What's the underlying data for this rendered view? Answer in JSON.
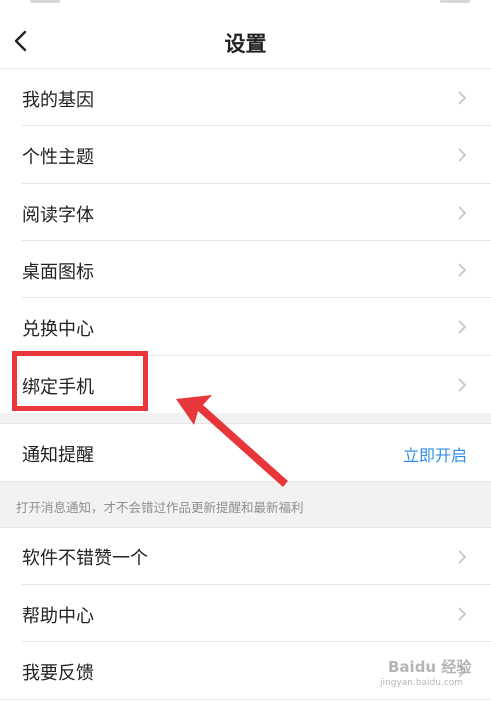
{
  "header": {
    "title": "设置"
  },
  "group1": [
    {
      "label": "我的基因"
    },
    {
      "label": "个性主题"
    },
    {
      "label": "阅读字体"
    },
    {
      "label": "桌面图标"
    },
    {
      "label": "兑换中心"
    },
    {
      "label": "绑定手机"
    }
  ],
  "notify": {
    "label": "通知提醒",
    "action": "立即开启",
    "hint": "打开消息通知，才不会错过作品更新提醒和最新福利"
  },
  "group2": [
    {
      "label": "软件不错赞一个"
    },
    {
      "label": "帮助中心"
    },
    {
      "label": "我要反馈"
    }
  ],
  "annotation": {
    "color": "#e8373b"
  },
  "accent": "#2f8ee6",
  "watermark": {
    "main": "Baidu 经验",
    "sub": "jingyan.baidu.com"
  }
}
